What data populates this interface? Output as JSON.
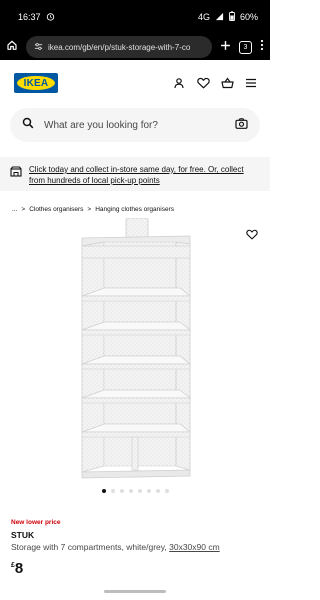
{
  "status_bar": {
    "time": "16:37",
    "network": "4G",
    "battery": "60%"
  },
  "browser": {
    "url": "ikea.com/gb/en/p/stuk-storage-with-7-co",
    "tab_count": "3"
  },
  "search": {
    "placeholder": "What are you looking for?"
  },
  "promo": {
    "text": "Click today and collect in-store same day, for free. Or, collect from hundreds of local pick-up points"
  },
  "breadcrumb": {
    "ellipsis": "...",
    "separator": ">",
    "items": [
      "Clothes organisers",
      "Hanging clothes organisers"
    ]
  },
  "gallery": {
    "image_count": 8,
    "active_index": 0
  },
  "product": {
    "badge": "New lower price",
    "name": "STUK",
    "description": "Storage with 7 compartments, white/grey,",
    "dimensions": "30x30x90 cm",
    "currency": "£",
    "price": "8"
  },
  "logo": {
    "text": "IKEA",
    "blue": "#0058a3",
    "yellow": "#ffdb00"
  },
  "colors": {
    "sale_red": "#cc0008"
  }
}
